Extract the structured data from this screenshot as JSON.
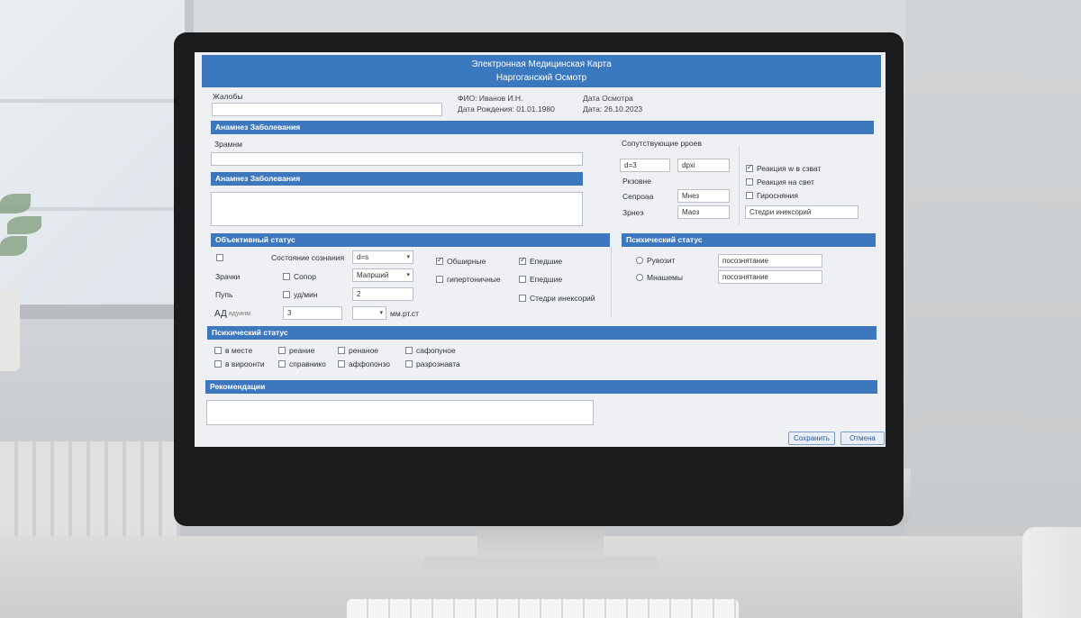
{
  "header": {
    "title": "Электронная Медицинская Карта",
    "subtitle": "Наргоганский Осмотр"
  },
  "patient": {
    "complaints_label": "Жалобы",
    "fio": "ФИО: Иванов И.Н.",
    "dob": "Дата Рождения: 01.01.1980",
    "exam_date_label": "Дата Осмотра",
    "exam_date": "Дата: 26.10.2023"
  },
  "anamnesis": {
    "bar1": "Анамнез Заболевания",
    "symptoms_label": "Зрамнм",
    "bar2": "Анамнез Заболевания"
  },
  "side_panel": {
    "title": "Сопутствующие рроев",
    "field1": "d=3",
    "field2": "dpxi",
    "row2_label": "Ркзовне",
    "row3_label": "Сепроаа",
    "row3_value": "Мнез",
    "row4_label": "Зрнеэ",
    "row4_value": "Маоз",
    "checks": [
      {
        "label": "Реакция w в сзват",
        "checked": true
      },
      {
        "label": "Реакция на свет",
        "checked": false
      },
      {
        "label": "Гиросняния",
        "checked": false
      }
    ],
    "other_field": "Стедри инексорий"
  },
  "objective": {
    "bar": "Объективный статус",
    "state_label": "Состояние сознания",
    "state_value": "d=s",
    "zrachki_label": "Зрачки",
    "sopor_label": "Сопор",
    "manyal_value": "Мапрший",
    "pulse_label": "Пупь",
    "pulse_sub_label": "уд/мин",
    "pulse_value": "2",
    "ad_label": "АД",
    "ad_sub_label": "ядуинм",
    "ad_value": "3",
    "ad_unit": "мм.рт.ст",
    "mid_checks": [
      {
        "label": "Обширные",
        "checked": true
      },
      {
        "label": "гипертоничные",
        "checked": false
      }
    ],
    "right_checks": [
      {
        "label": "Епедшие",
        "checked": true
      },
      {
        "label": "Епедшие",
        "checked": false
      },
      {
        "label": "Стедри инексорий",
        "checked": false
      }
    ]
  },
  "psych_right": {
    "bar": "Психический статус",
    "row1_label": "Рувозит",
    "row1_value": "посознятание",
    "row2_label": "Мнашемы",
    "row2_value": "посознятание"
  },
  "psych": {
    "bar": "Психический статус",
    "options": [
      "в месте",
      "реание",
      "ренаное",
      "сафопуное",
      "в вироонти",
      "справнико",
      "аффопонзо",
      "разрознавта"
    ]
  },
  "recommendations": {
    "bar": "Рекомендации"
  },
  "actions": {
    "save": "Сохранить",
    "cancel": "Отмена"
  }
}
